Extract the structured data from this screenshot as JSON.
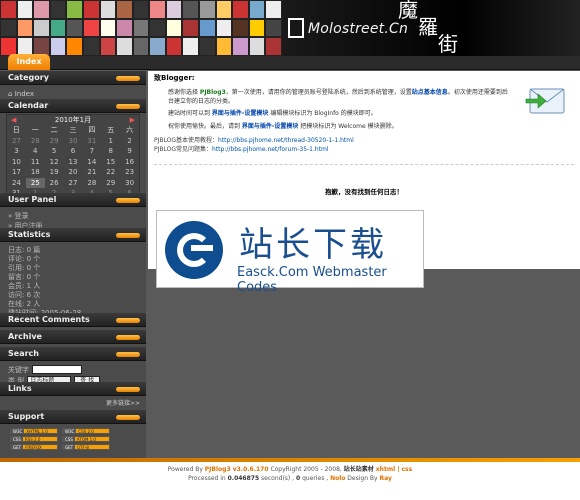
{
  "header": {
    "logo_text": "Molostreet.Cn",
    "logo_cn": "魔羅街",
    "tile_colors": [
      "#c33",
      "#eee",
      "#d9a",
      "#333",
      "#8b4",
      "#c33",
      "#ddd",
      "#a64",
      "#333",
      "#e88",
      "#dcd",
      "#555",
      "#999",
      "#fc6",
      "#c33",
      "#7ac",
      "#eee",
      "#333",
      "#f96",
      "#ccc",
      "#4a8",
      "#555",
      "#e44",
      "#ffe",
      "#c8a",
      "#777",
      "#333",
      "#ffd",
      "#a33",
      "#69c",
      "#eee",
      "#532",
      "#fc0",
      "#444",
      "#e33",
      "#eee",
      "#744",
      "#cce",
      "#f80",
      "#333",
      "#c44",
      "#ddd",
      "#666",
      "#8ac",
      "#c33",
      "#eee",
      "#333",
      "#fb3",
      "#c9c",
      "#ddd",
      "#a33"
    ]
  },
  "nav": {
    "tab_index": "Index"
  },
  "sidebar": {
    "category": {
      "title": "Category",
      "home": "Index"
    },
    "calendar": {
      "title": "Calendar",
      "month_label": "2010年1月",
      "prev": "◀",
      "next": "▶",
      "weekdays": [
        "日",
        "一",
        "二",
        "三",
        "四",
        "五",
        "六"
      ],
      "days": [
        [
          "27",
          "28",
          "29",
          "30",
          "31",
          "1",
          "2"
        ],
        [
          "3",
          "4",
          "5",
          "6",
          "7",
          "8",
          "9"
        ],
        [
          "10",
          "11",
          "12",
          "13",
          "14",
          "15",
          "16"
        ],
        [
          "17",
          "18",
          "19",
          "20",
          "21",
          "22",
          "23"
        ],
        [
          "24",
          "25",
          "26",
          "27",
          "28",
          "29",
          "30"
        ],
        [
          "31",
          "1",
          "2",
          "3",
          "4",
          "5",
          "6"
        ]
      ],
      "today": "25"
    },
    "user_panel": {
      "title": "User Panel",
      "items": [
        "» 登录",
        "» 用户注册"
      ]
    },
    "statistics": {
      "title": "Statistics",
      "lines": [
        "日志: 0 篇",
        "评论: 0 个",
        "引用: 0 个",
        "留言: 0 个",
        "会员: 1 人",
        "访问: 6 次",
        "在线: 2 人",
        "建站时间: 2005-06-28"
      ]
    },
    "recent_comments": {
      "title": "Recent Comments"
    },
    "archive": {
      "title": "Archive"
    },
    "search": {
      "title": "Search",
      "keyword_label": "关键字",
      "type_label": "类 型",
      "select_value": "日志标题",
      "button": "查 找"
    },
    "links": {
      "title": "Links",
      "more": "更多链接>>"
    },
    "support": {
      "title": "Support",
      "badges": [
        {
          "l": "W3C",
          "r": "XHTML 1.0"
        },
        {
          "l": "W3C",
          "r": "CSS 2.0"
        },
        {
          "l": "CSS",
          "r": "RSS 2.0"
        },
        {
          "l": "CSS",
          "r": "ATOM 1.0"
        },
        {
          "l": "GET",
          "r": "FIREFOX"
        },
        {
          "l": "GET",
          "r": "UTF-8"
        }
      ]
    }
  },
  "content": {
    "greeting": "致Blogger:",
    "p1_a": "感谢你选择 ",
    "p1_link": "PJBlog3",
    "p1_b": "，第一次使用，请用你的管理员账号登陆系统，然后到系统管理，设置",
    "p1_settings": "站点基本信息",
    "p1_c": "。初次使用还需要到后台建立你的日志的分类。",
    "p2_a": "建站时间可以到 ",
    "p2_link": "界面与插件-设置模块",
    "p2_b": " 编辑模块标识为 BlogInfo 的模块即可。",
    "p3_a": "祝你使用愉快。最后，请到 ",
    "p3_link": "界面与插件-设置模块",
    "p3_b": " 把模块标识为 Welcome 模块删除。",
    "help1_label": "PJBLOG基本使用教程：",
    "help1_url": "http://bbs.pjhome.net/thread-30520-1-1.html",
    "help2_label": "PJBLOG常见问题集：",
    "help2_url": "http://bbs.pjhome.net/forum-35-1.html",
    "not_found": "抱歉，没有找到任何日志！",
    "watermark_title": "站长下载",
    "watermark_sub": "Easck.Com Webmaster Codes"
  },
  "footer": {
    "line1_a": "Powered By ",
    "line1_pj": "PJBlog3 v3.0.6.170",
    "line1_b": " CopyRight 2005 - 2008, ",
    "line1_site": "站长站素材",
    "line1_c": " xhtml | css",
    "line2_a": "Processed in ",
    "line2_time": "0.046875",
    "line2_b": " second(s) , ",
    "line2_q": "0",
    "line2_c": " queries , ",
    "line2_theme": "Nolo",
    "line2_d": " Design By ",
    "line2_author": "Ray"
  }
}
